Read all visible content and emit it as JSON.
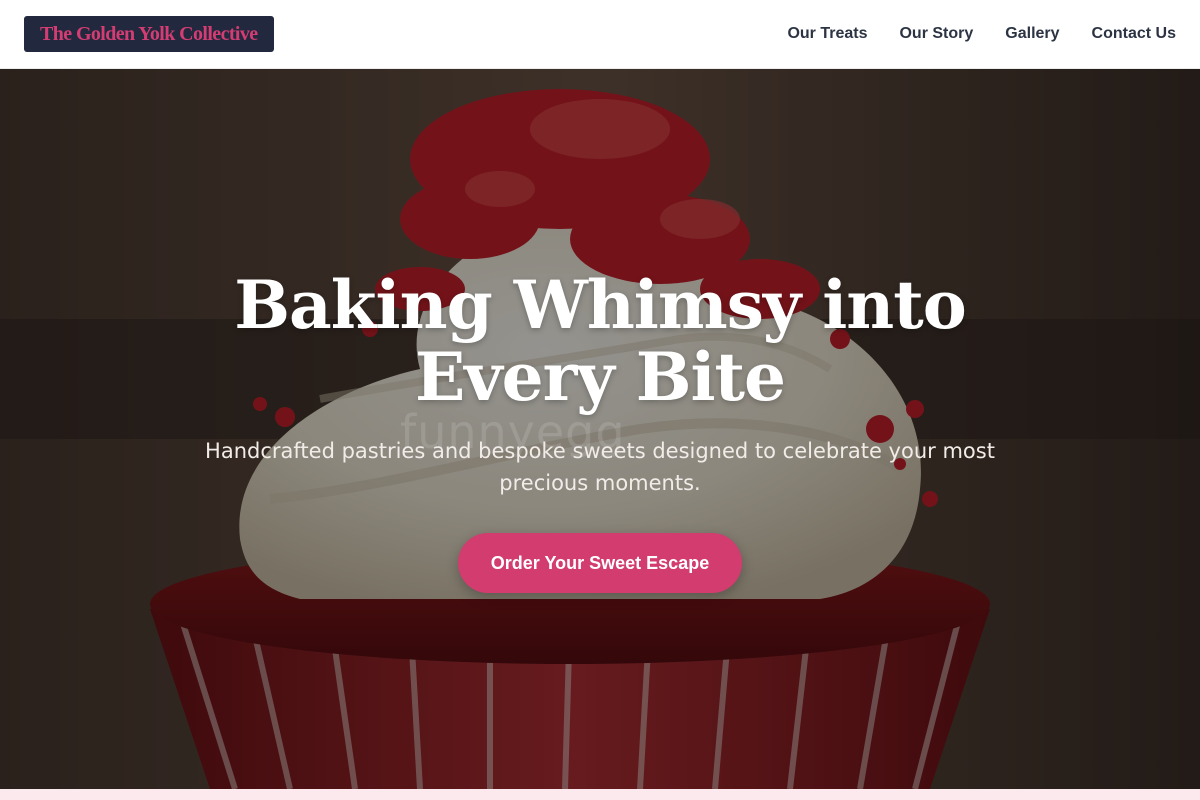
{
  "header": {
    "logo_text": "The Golden Yolk Collective",
    "nav": [
      {
        "label": "Our Treats"
      },
      {
        "label": "Our Story"
      },
      {
        "label": "Gallery"
      },
      {
        "label": "Contact Us"
      }
    ]
  },
  "hero": {
    "title": "Baking Whimsy into Every Bite",
    "subtitle": "Handcrafted pastries and bespoke sweets designed to celebrate your most precious moments.",
    "cta_label": "Order Your Sweet Escape",
    "watermark_text": "funnyegg",
    "image_subject": "red velvet cupcake with white frosting and red crumb topping"
  },
  "colors": {
    "brand_pink": "#d23c6f",
    "logo_background": "#22283d",
    "nav_text": "#2c3444",
    "hero_title": "#ffffff"
  }
}
